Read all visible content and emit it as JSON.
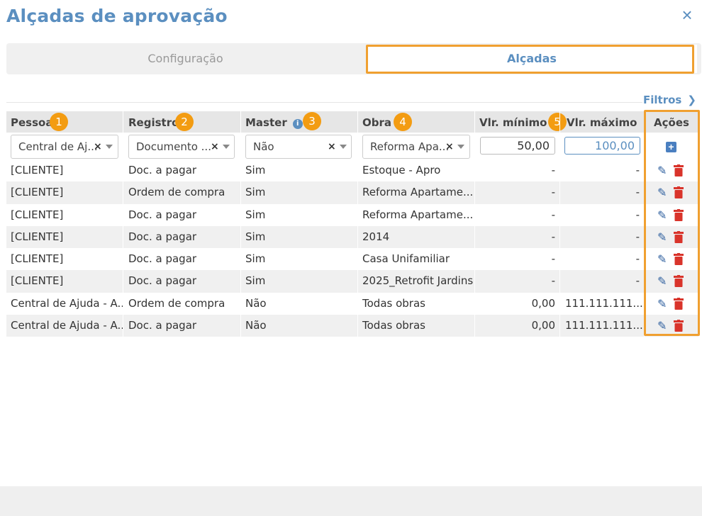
{
  "dialog": {
    "title": "Alçadas de aprovação",
    "close_icon": "close-icon"
  },
  "tabs": [
    {
      "label": "Configuração",
      "active": false
    },
    {
      "label": "Alçadas",
      "active": true
    }
  ],
  "filters_link": {
    "label": "Filtros",
    "icon": "chevron-right-icon"
  },
  "columns": {
    "pessoa": "Pessoa",
    "registro": "Registro",
    "master": "Master",
    "obra": "Obra",
    "vlr_minimo": "Vlr. mínimo",
    "vlr_maximo": "Vlr. máximo",
    "acoes": "Ações"
  },
  "badges": [
    "1",
    "2",
    "3",
    "4",
    "5"
  ],
  "filter_values": {
    "pessoa": "Central de Aj...",
    "registro": "Documento ...",
    "master": "Não",
    "obra": "Reforma Apa...",
    "vlr_minimo": "50,00",
    "vlr_maximo": "100,00"
  },
  "rows": [
    {
      "pessoa": "[CLIENTE]",
      "registro": "Doc. a pagar",
      "master": "Sim",
      "obra": "Estoque - Apro",
      "min": "-",
      "max": "-"
    },
    {
      "pessoa": "[CLIENTE]",
      "registro": "Ordem de compra",
      "master": "Sim",
      "obra": "Reforma Apartame...",
      "min": "-",
      "max": "-"
    },
    {
      "pessoa": "[CLIENTE]",
      "registro": "Doc. a pagar",
      "master": "Sim",
      "obra": "Reforma Apartame...",
      "min": "-",
      "max": "-"
    },
    {
      "pessoa": "[CLIENTE]",
      "registro": "Doc. a pagar",
      "master": "Sim",
      "obra": "2014",
      "min": "-",
      "max": "-"
    },
    {
      "pessoa": "[CLIENTE]",
      "registro": "Doc. a pagar",
      "master": "Sim",
      "obra": "Casa Unifamiliar",
      "min": "-",
      "max": "-"
    },
    {
      "pessoa": "[CLIENTE]",
      "registro": "Doc. a pagar",
      "master": "Sim",
      "obra": "2025_Retrofit Jardins",
      "min": "-",
      "max": "-"
    },
    {
      "pessoa": "Central de Ajuda - A...",
      "registro": "Ordem de compra",
      "master": "Não",
      "obra": "Todas obras",
      "min": "0,00",
      "max": "111.111.111...."
    },
    {
      "pessoa": "Central de Ajuda - A...",
      "registro": "Doc. a pagar",
      "master": "Não",
      "obra": "Todas obras",
      "min": "0,00",
      "max": "111.111.111...."
    }
  ],
  "colors": {
    "accent": "#5b8fc0",
    "highlight": "#f0a030",
    "badge": "#f39c12",
    "delete": "#d9342b",
    "edit": "#2e5f9e"
  }
}
